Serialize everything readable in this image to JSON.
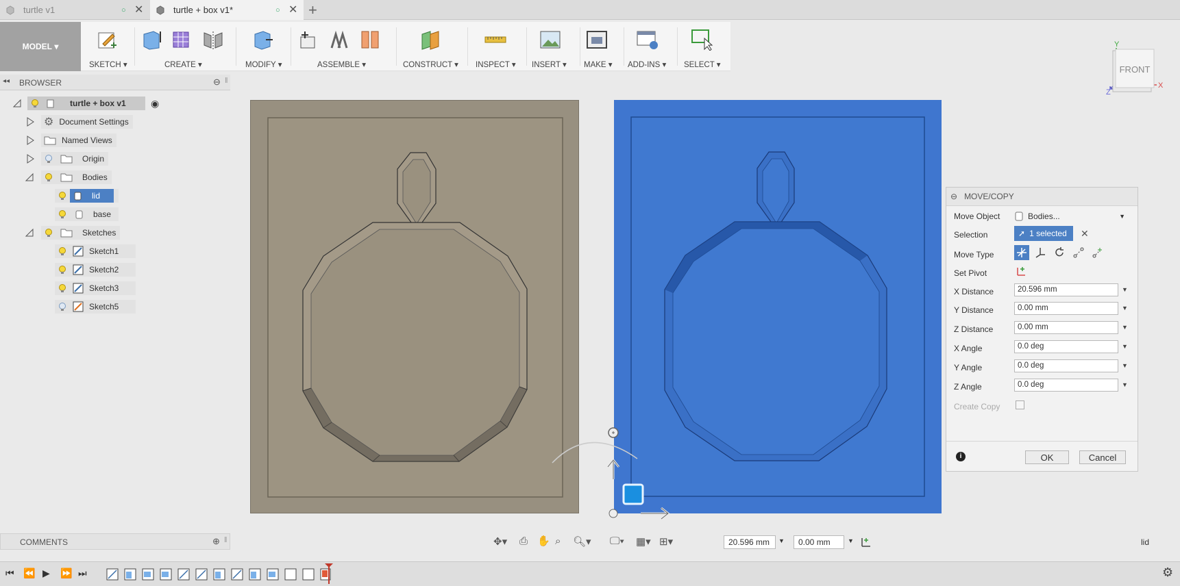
{
  "tabs": [
    {
      "label": "turtle v1",
      "active": false
    },
    {
      "label": "turtle + box v1*",
      "active": true
    }
  ],
  "toolbar": {
    "model_label": "MODEL",
    "groups": [
      "SKETCH",
      "CREATE",
      "MODIFY",
      "ASSEMBLE",
      "CONSTRUCT",
      "INSPECT",
      "INSERT",
      "MAKE",
      "ADD-INS",
      "SELECT"
    ]
  },
  "browser": {
    "title": "BROWSER",
    "root": "turtle + box v1",
    "items": [
      "Document Settings",
      "Named Views",
      "Origin",
      "Bodies",
      "lid",
      "base",
      "Sketches",
      "Sketch1",
      "Sketch2",
      "Sketch3",
      "Sketch5"
    ]
  },
  "viewcube": {
    "face": "FRONT",
    "axis_y": "Y",
    "axis_x": "X",
    "axis_z": "Z"
  },
  "dialog": {
    "title": "MOVE/COPY",
    "move_object_label": "Move Object",
    "move_object_value": "Bodies...",
    "selection_label": "Selection",
    "selection_value": "1 selected",
    "move_type_label": "Move Type",
    "set_pivot_label": "Set Pivot",
    "fields": [
      {
        "label": "X Distance",
        "value": "20.596 mm"
      },
      {
        "label": "Y Distance",
        "value": "0.00 mm"
      },
      {
        "label": "Z Distance",
        "value": "0.00 mm"
      },
      {
        "label": "X Angle",
        "value": "0.0 deg"
      },
      {
        "label": "Y Angle",
        "value": "0.0 deg"
      },
      {
        "label": "Z Angle",
        "value": "0.0 deg"
      }
    ],
    "create_copy_label": "Create Copy",
    "ok_label": "OK",
    "cancel_label": "Cancel"
  },
  "comments_label": "COMMENTS",
  "navbar": {
    "value1": "20.596 mm",
    "value2": "0.00 mm"
  },
  "status": {
    "selection": "lid"
  },
  "colors": {
    "accent": "#4c80c4",
    "selected_body": "#3f76cf",
    "base_body": "#989080"
  }
}
